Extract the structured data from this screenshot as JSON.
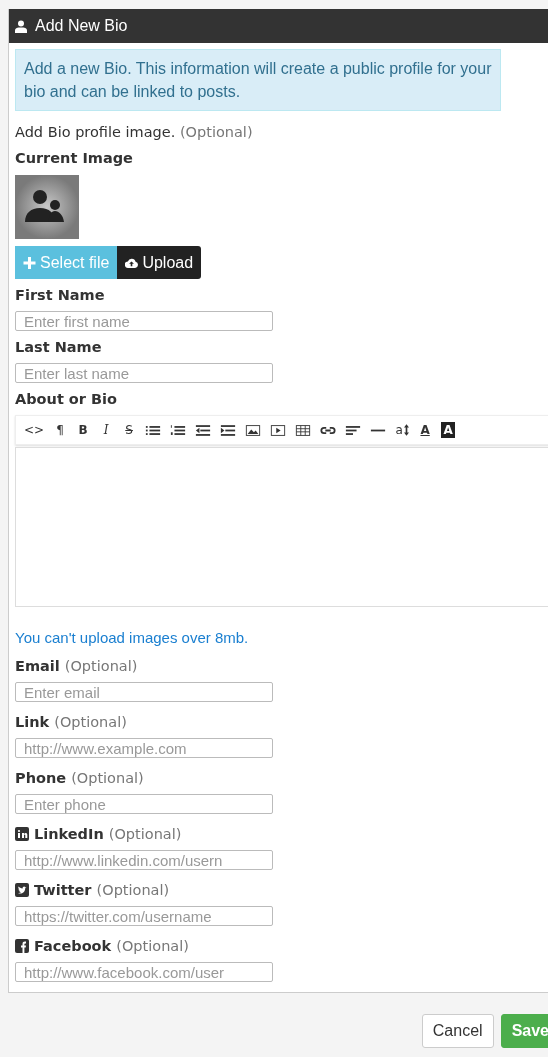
{
  "panel": {
    "title": "Add New Bio"
  },
  "alert": "Add a new Bio. This information will create a public profile for your bio and can be linked to posts.",
  "image_section": {
    "label": "Add Bio profile image.",
    "optional": "(Optional)",
    "current_label": "Current Image"
  },
  "upload_buttons": [
    {
      "kind": "select",
      "label": "Select file"
    },
    {
      "kind": "upload",
      "label": "Upload"
    }
  ],
  "name_fields": [
    {
      "label": "First Name",
      "placeholder": "Enter first name"
    },
    {
      "label": "Last Name",
      "placeholder": "Enter last name"
    }
  ],
  "editor": {
    "label": "About or Bio",
    "toolbar": [
      {
        "kind": "text",
        "label": "<>"
      },
      {
        "kind": "text",
        "label": "¶"
      },
      {
        "kind": "bold",
        "label": "B"
      },
      {
        "kind": "italic",
        "label": "I"
      },
      {
        "kind": "strike",
        "label": "S"
      },
      {
        "kind": "bullet-list"
      },
      {
        "kind": "number-list"
      },
      {
        "kind": "outdent"
      },
      {
        "kind": "indent"
      },
      {
        "kind": "image"
      },
      {
        "kind": "video"
      },
      {
        "kind": "table"
      },
      {
        "kind": "link"
      },
      {
        "kind": "align"
      },
      {
        "kind": "rule"
      },
      {
        "kind": "font-size",
        "label": "a"
      },
      {
        "kind": "font-color",
        "label": "A"
      },
      {
        "kind": "back-color",
        "label": "A"
      }
    ]
  },
  "note": "You can't upload images over 8mb.",
  "fields": [
    {
      "kind": "plain",
      "label": "Email",
      "optional": "(Optional)",
      "placeholder": "Enter email"
    },
    {
      "kind": "plain",
      "label": "Link",
      "optional": "(Optional)",
      "placeholder": "http://www.example.com"
    },
    {
      "kind": "plain",
      "label": "Phone",
      "optional": "(Optional)",
      "placeholder": "Enter phone"
    },
    {
      "kind": "linkedin",
      "label": "LinkedIn",
      "optional": "(Optional)",
      "placeholder": "http://www.linkedin.com/usern"
    },
    {
      "kind": "twitter",
      "label": "Twitter",
      "optional": "(Optional)",
      "placeholder": "https://twitter.com/username"
    },
    {
      "kind": "facebook",
      "label": "Facebook",
      "optional": "(Optional)",
      "placeholder": "http://www.facebook.com/user"
    }
  ],
  "footer_buttons": [
    {
      "kind": "cancel",
      "label": "Cancel"
    },
    {
      "kind": "save",
      "label": "Save"
    }
  ]
}
